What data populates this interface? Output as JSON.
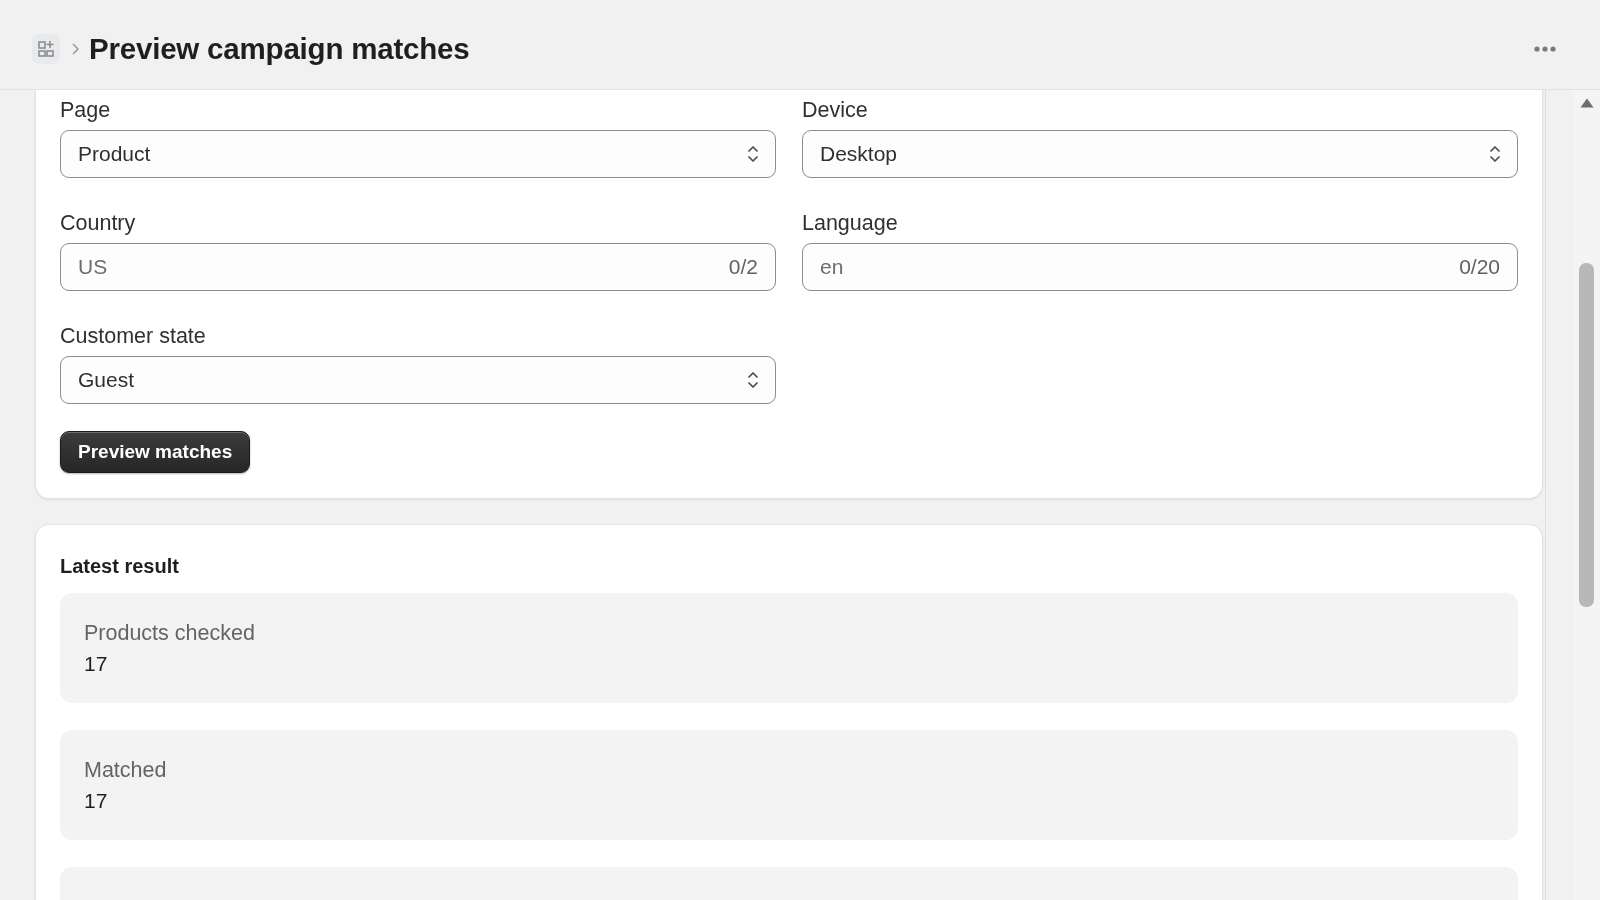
{
  "header": {
    "title": "Preview campaign matches"
  },
  "form": {
    "fields": [
      {
        "kind": "select",
        "label": "Page",
        "value": "Product"
      },
      {
        "kind": "select",
        "label": "Device",
        "value": "Desktop"
      },
      {
        "kind": "text",
        "label": "Country",
        "placeholder": "US",
        "counter": "0/2"
      },
      {
        "kind": "text",
        "label": "Language",
        "placeholder": "en",
        "counter": "0/20"
      },
      {
        "kind": "select",
        "label": "Customer state",
        "value": "Guest"
      }
    ],
    "button": "Preview matches"
  },
  "result": {
    "title": "Latest result",
    "stats": [
      {
        "label": "Products checked",
        "value": "17"
      },
      {
        "label": "Matched",
        "value": "17"
      }
    ]
  }
}
